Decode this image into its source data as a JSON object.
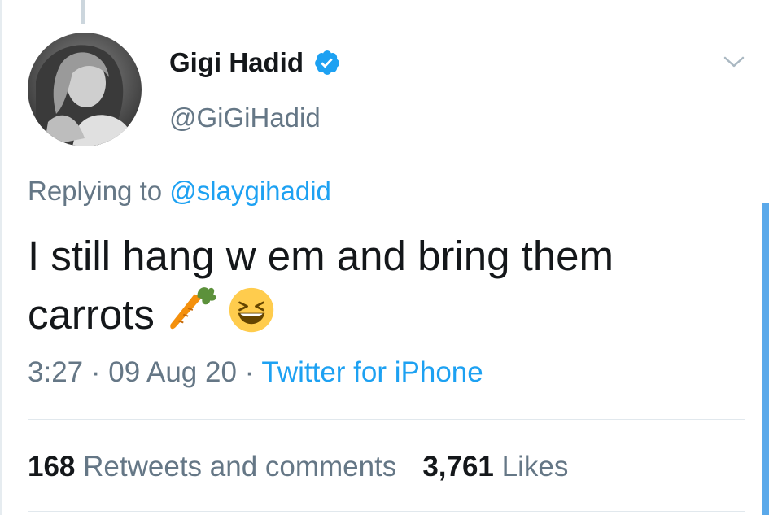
{
  "tweet": {
    "display_name": "Gigi Hadid",
    "handle": "@GiGiHadid",
    "replying_prefix": "Replying to",
    "replying_to": "@slaygihadid",
    "text_line1": "I still hang w em and bring them",
    "text_line2": "carrots",
    "emojis": [
      "carrot-emoji",
      "grinning-squinting-face-emoji"
    ],
    "time": "3:27",
    "date": "09 Aug 20",
    "separator": "·",
    "source": "Twitter for iPhone"
  },
  "stats": {
    "retweets_count": "168",
    "retweets_label": "Retweets and comments",
    "likes_count": "3,761",
    "likes_label": "Likes"
  },
  "icons": {
    "verified": "verified-badge-icon",
    "menu": "chevron-down-icon"
  },
  "colors": {
    "link_blue": "#1da1f2",
    "secondary_text": "#657786",
    "primary_text": "#14171a"
  }
}
